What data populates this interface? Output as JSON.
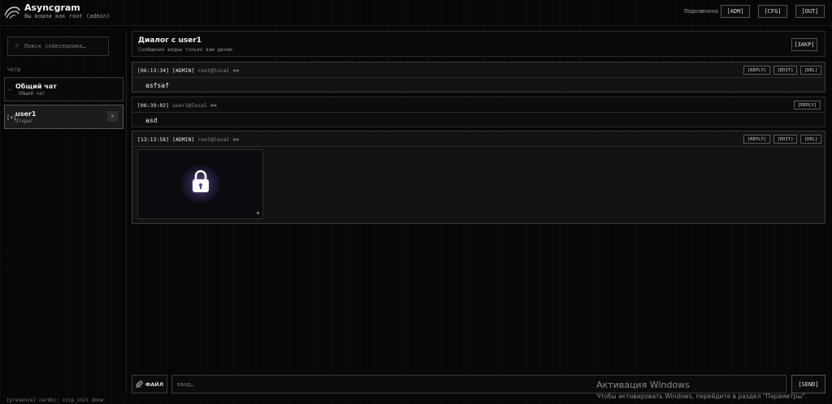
{
  "header": {
    "app_title": "Asyncgram",
    "subtitle": "Вы вошли как root (admin)",
    "connection_status": "Подключено",
    "buttons": {
      "adm": "[ADM]",
      "cfg": "[CFG]",
      "out": "[OUT]"
    }
  },
  "sidebar": {
    "search": {
      "placeholder": "Поиск собеседника…",
      "value": ""
    },
    "section_label": "ЧАТЫ",
    "chats": [
      {
        "name": "Общий чат",
        "subtitle": "Общий чат",
        "tag": "",
        "active": false
      },
      {
        "name": "user1",
        "subtitle": "Открыт",
        "tag": "[+]",
        "close": "×",
        "active": true
      }
    ]
  },
  "dialog": {
    "title": "Диалог с user1",
    "subtitle": "Сообщения видны только вам двоим",
    "close_label": "[ЗАКР]"
  },
  "messages": [
    {
      "time": "[06:13:34]",
      "role": "[ADMIN]",
      "user": "root@local",
      "arrow": ">>",
      "text": "asfsaf",
      "actions": [
        "[REPLY]",
        "[EDIT]",
        "[DEL]"
      ]
    },
    {
      "time": "[06:39:02]",
      "role": "",
      "user": "user1@local",
      "arrow": ">>",
      "text": "asd",
      "actions": [
        "[REPLY]"
      ]
    },
    {
      "time": "[13:13:58]",
      "role": "[ADMIN]",
      "user": "root@local",
      "arrow": ">>",
      "text": "",
      "attachment": {
        "type": "image",
        "icon": "lock-icon",
        "expand": "+"
      },
      "actions": [
        "[REPLY]",
        "[EDIT]",
        "[DEL]"
      ]
    }
  ],
  "composer": {
    "file_label": "ФАЙЛ",
    "input_placeholder": "ввод…",
    "input_value": "",
    "send_label": "[SEND]"
  },
  "status_bar": "[presence] cardnc: сccp_init done",
  "os_watermark": {
    "title": "Активация Windows",
    "subtitle": "Чтобы активировать Windows, перейдите в раздел \"Параметры\"."
  },
  "colors": {
    "background": "#070707",
    "panel": "#131313",
    "active_chat": "#1c1c1c",
    "border": "#3a3a3a",
    "text": "#f0f0f0",
    "muted": "#8f8f8f",
    "lock_glow": "#c79bff"
  }
}
